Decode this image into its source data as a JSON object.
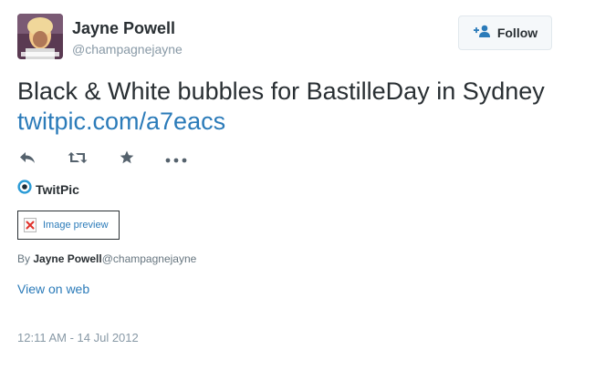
{
  "author": {
    "name": "Jayne Powell",
    "handle": "@champagnejayne"
  },
  "follow_button": {
    "label": "Follow"
  },
  "tweet": {
    "text": "Black & White bubbles for BastilleDay in Sydney",
    "link": "twitpic.com/a7eacs"
  },
  "actions": {
    "icons": [
      "reply-icon",
      "retweet-icon",
      "favorite-icon",
      "more-icon"
    ]
  },
  "card": {
    "source_name": "TwitPic",
    "image_preview_label": "Image preview",
    "byline_prefix": "By",
    "byline_name": "Jayne Powell",
    "byline_handle": "@champagnejayne"
  },
  "view_on_web": "View on web",
  "timestamp": "12:11 AM - 14 Jul 2012",
  "colors": {
    "link": "#2b7bb9",
    "text": "#292f33",
    "muted": "#8899a6",
    "action_icon": "#55626d"
  }
}
